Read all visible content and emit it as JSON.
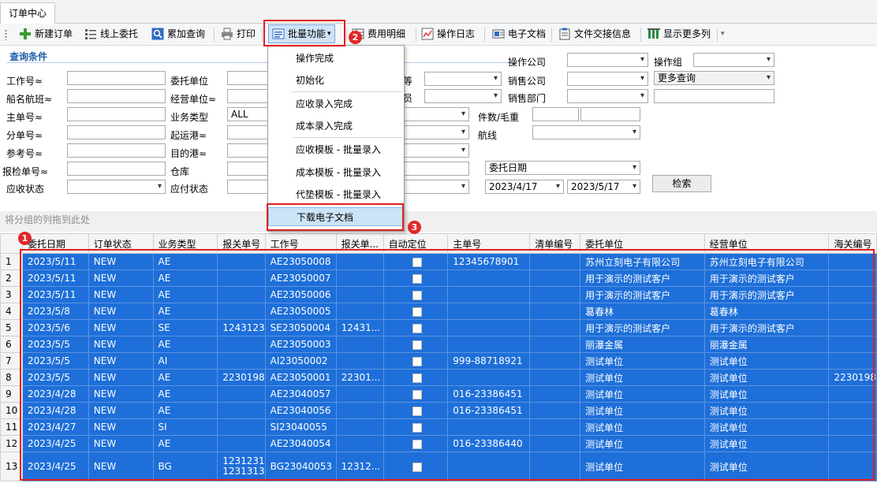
{
  "tab": {
    "title": "订单中心"
  },
  "toolbar": {
    "new_order": "新建订单",
    "online_delegate": "线上委托",
    "cumulative_query": "累加查询",
    "print": "打印",
    "batch": "批量功能",
    "fee_detail": "费用明细",
    "op_log": "操作日志",
    "e_doc": "电子文档",
    "file_handover": "文件交接信息",
    "more_cols": "显示更多列"
  },
  "query": {
    "title": "查询条件",
    "labels": {
      "job_no": "工作号≈",
      "ship_voyage": "船名航班≈",
      "mbl": "主单号≈",
      "hbl": "分单号≈",
      "ref_no": "参考号≈",
      "insp_no": "报检单号≈",
      "ar_status": "应收状态",
      "client": "委托单位",
      "operator_unit": "经营单位≈",
      "biz_type": "业务类型",
      "pol": "起运港≈",
      "pod": "目的港≈",
      "warehouse": "仓库",
      "ap_status": "应付状态",
      "op_company": "操作公司",
      "op_group": "操作组",
      "sales_company": "销售公司",
      "sales_dept": "销售部门",
      "pieces_weight": "件数/毛重",
      "route": "航线",
      "partial_a": "等",
      "partial_b": "员"
    },
    "biz_type_value": "ALL",
    "more_query": "更多查询",
    "date_type": "委托日期",
    "date_from": "2023/4/17",
    "date_to": "2023/5/17",
    "search_btn": "检索"
  },
  "menu": {
    "items": [
      "操作完成",
      "初始化",
      "应收录入完成",
      "成本录入完成",
      "应收模板 - 批量录入",
      "成本模板 - 批量录入",
      "代垫模板 - 批量录入",
      "下载电子文档"
    ]
  },
  "badges": [
    "1",
    "2",
    "3"
  ],
  "grid": {
    "group_hint": "将分组的列拖到此处",
    "columns": [
      "委托日期",
      "订单状态",
      "业务类型",
      "报关单号",
      "工作号",
      "报关单...",
      "自动定位",
      "主单号",
      "清单编号",
      "委托单位",
      "经营单位",
      "海关编号"
    ],
    "rows": [
      {
        "n": "1",
        "date": "2023/5/11",
        "status": "NEW",
        "type": "AE",
        "cd": "",
        "job": "AE23050008",
        "cd2": "",
        "mbl": "12345678901",
        "list": "",
        "client": "苏州立刻电子有限公司",
        "op": "苏州立刻电子有限公司",
        "customs": ""
      },
      {
        "n": "2",
        "date": "2023/5/11",
        "status": "NEW",
        "type": "AE",
        "cd": "",
        "job": "AE23050007",
        "cd2": "",
        "mbl": "",
        "list": "",
        "client": "用于演示的测试客户",
        "op": "用于演示的测试客户",
        "customs": ""
      },
      {
        "n": "3",
        "date": "2023/5/11",
        "status": "NEW",
        "type": "AE",
        "cd": "",
        "job": "AE23050006",
        "cd2": "",
        "mbl": "",
        "list": "",
        "client": "用于演示的测试客户",
        "op": "用于演示的测试客户",
        "customs": ""
      },
      {
        "n": "4",
        "date": "2023/5/8",
        "status": "NEW",
        "type": "AE",
        "cd": "",
        "job": "AE23050005",
        "cd2": "",
        "mbl": "",
        "list": "",
        "client": "葛春林",
        "op": "葛春林",
        "customs": ""
      },
      {
        "n": "5",
        "date": "2023/5/6",
        "status": "NEW",
        "type": "SE",
        "cd": "1243123",
        "job": "SE23050004",
        "cd2": "12431...",
        "mbl": "",
        "list": "",
        "client": "用于演示的测试客户",
        "op": "用于演示的测试客户",
        "customs": ""
      },
      {
        "n": "6",
        "date": "2023/5/5",
        "status": "NEW",
        "type": "AE",
        "cd": "",
        "job": "AE23050003",
        "cd2": "",
        "mbl": "",
        "list": "",
        "client": "丽瀑金属",
        "op": "丽瀑金属",
        "customs": ""
      },
      {
        "n": "7",
        "date": "2023/5/5",
        "status": "NEW",
        "type": "AI",
        "cd": "",
        "job": "AI23050002",
        "cd2": "",
        "mbl": "999-88718921",
        "list": "",
        "client": "测试单位",
        "op": "测试单位",
        "customs": ""
      },
      {
        "n": "8",
        "date": "2023/5/5",
        "status": "NEW",
        "type": "AE",
        "cd": "2230198",
        "job": "AE23050001",
        "cd2": "22301...",
        "mbl": "",
        "list": "",
        "client": "测试单位",
        "op": "测试单位",
        "customs": "2230198"
      },
      {
        "n": "9",
        "date": "2023/4/28",
        "status": "NEW",
        "type": "AE",
        "cd": "",
        "job": "AE23040057",
        "cd2": "",
        "mbl": "016-23386451",
        "list": "",
        "client": "测试单位",
        "op": "测试单位",
        "customs": ""
      },
      {
        "n": "10",
        "date": "2023/4/28",
        "status": "NEW",
        "type": "AE",
        "cd": "",
        "job": "AE23040056",
        "cd2": "",
        "mbl": "016-23386451",
        "list": "",
        "client": "测试单位",
        "op": "测试单位",
        "customs": ""
      },
      {
        "n": "11",
        "date": "2023/4/27",
        "status": "NEW",
        "type": "SI",
        "cd": "",
        "job": "SI23040055",
        "cd2": "",
        "mbl": "",
        "list": "",
        "client": "测试单位",
        "op": "测试单位",
        "customs": ""
      },
      {
        "n": "12",
        "date": "2023/4/25",
        "status": "NEW",
        "type": "AE",
        "cd": "",
        "job": "AE23040054",
        "cd2": "",
        "mbl": "016-23386440",
        "list": "",
        "client": "测试单位",
        "op": "测试单位",
        "customs": ""
      },
      {
        "n": "13",
        "date": "2023/4/25",
        "status": "NEW",
        "type": "BG",
        "cd": "1231231",
        "cd_line2": "1231313",
        "job": "BG23040053",
        "cd2": "12312...",
        "mbl": "",
        "list": "",
        "client": "测试单位",
        "op": "测试单位",
        "customs": ""
      }
    ]
  },
  "colors": {
    "selection": "#1e6fd9",
    "highlight_box": "#e02020",
    "badge": "#e02828",
    "query_title": "#1f5fa8"
  }
}
